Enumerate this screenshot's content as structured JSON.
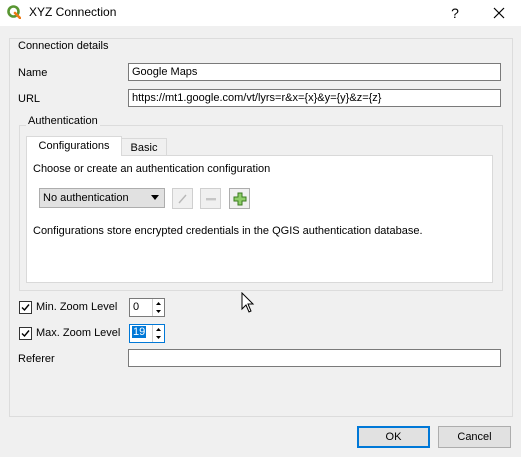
{
  "window": {
    "title": "XYZ Connection",
    "help_label": "?",
    "close_label": "✕"
  },
  "connection_details": {
    "group_title": "Connection details",
    "name_label": "Name",
    "name_value": "Google Maps",
    "url_label": "URL",
    "url_value": "https://mt1.google.com/vt/lyrs=r&x={x}&y={y}&z={z}"
  },
  "authentication": {
    "group_title": "Authentication",
    "tabs": [
      {
        "label": "Configurations",
        "active": true
      },
      {
        "label": "Basic",
        "active": false
      }
    ],
    "prompt": "Choose or create an authentication configuration",
    "selected_config": "No authentication",
    "info": "Configurations store encrypted credentials in the QGIS authentication database."
  },
  "zoom": {
    "min_label": "Min. Zoom Level",
    "min_value": "0",
    "min_checked": true,
    "max_label": "Max. Zoom Level",
    "max_value": "19",
    "max_checked": true
  },
  "referer": {
    "label": "Referer",
    "value": ""
  },
  "buttons": {
    "ok": "OK",
    "cancel": "Cancel"
  },
  "colors": {
    "accent": "#0078d7",
    "logo_green": "#589632",
    "logo_yellow": "#ee7913"
  },
  "icons": [
    "qgis-logo-icon",
    "help-icon",
    "close-icon",
    "edit-pencil-icon",
    "remove-icon",
    "add-icon",
    "check-icon",
    "spin-up-icon",
    "spin-down-icon",
    "chevron-down-icon"
  ]
}
